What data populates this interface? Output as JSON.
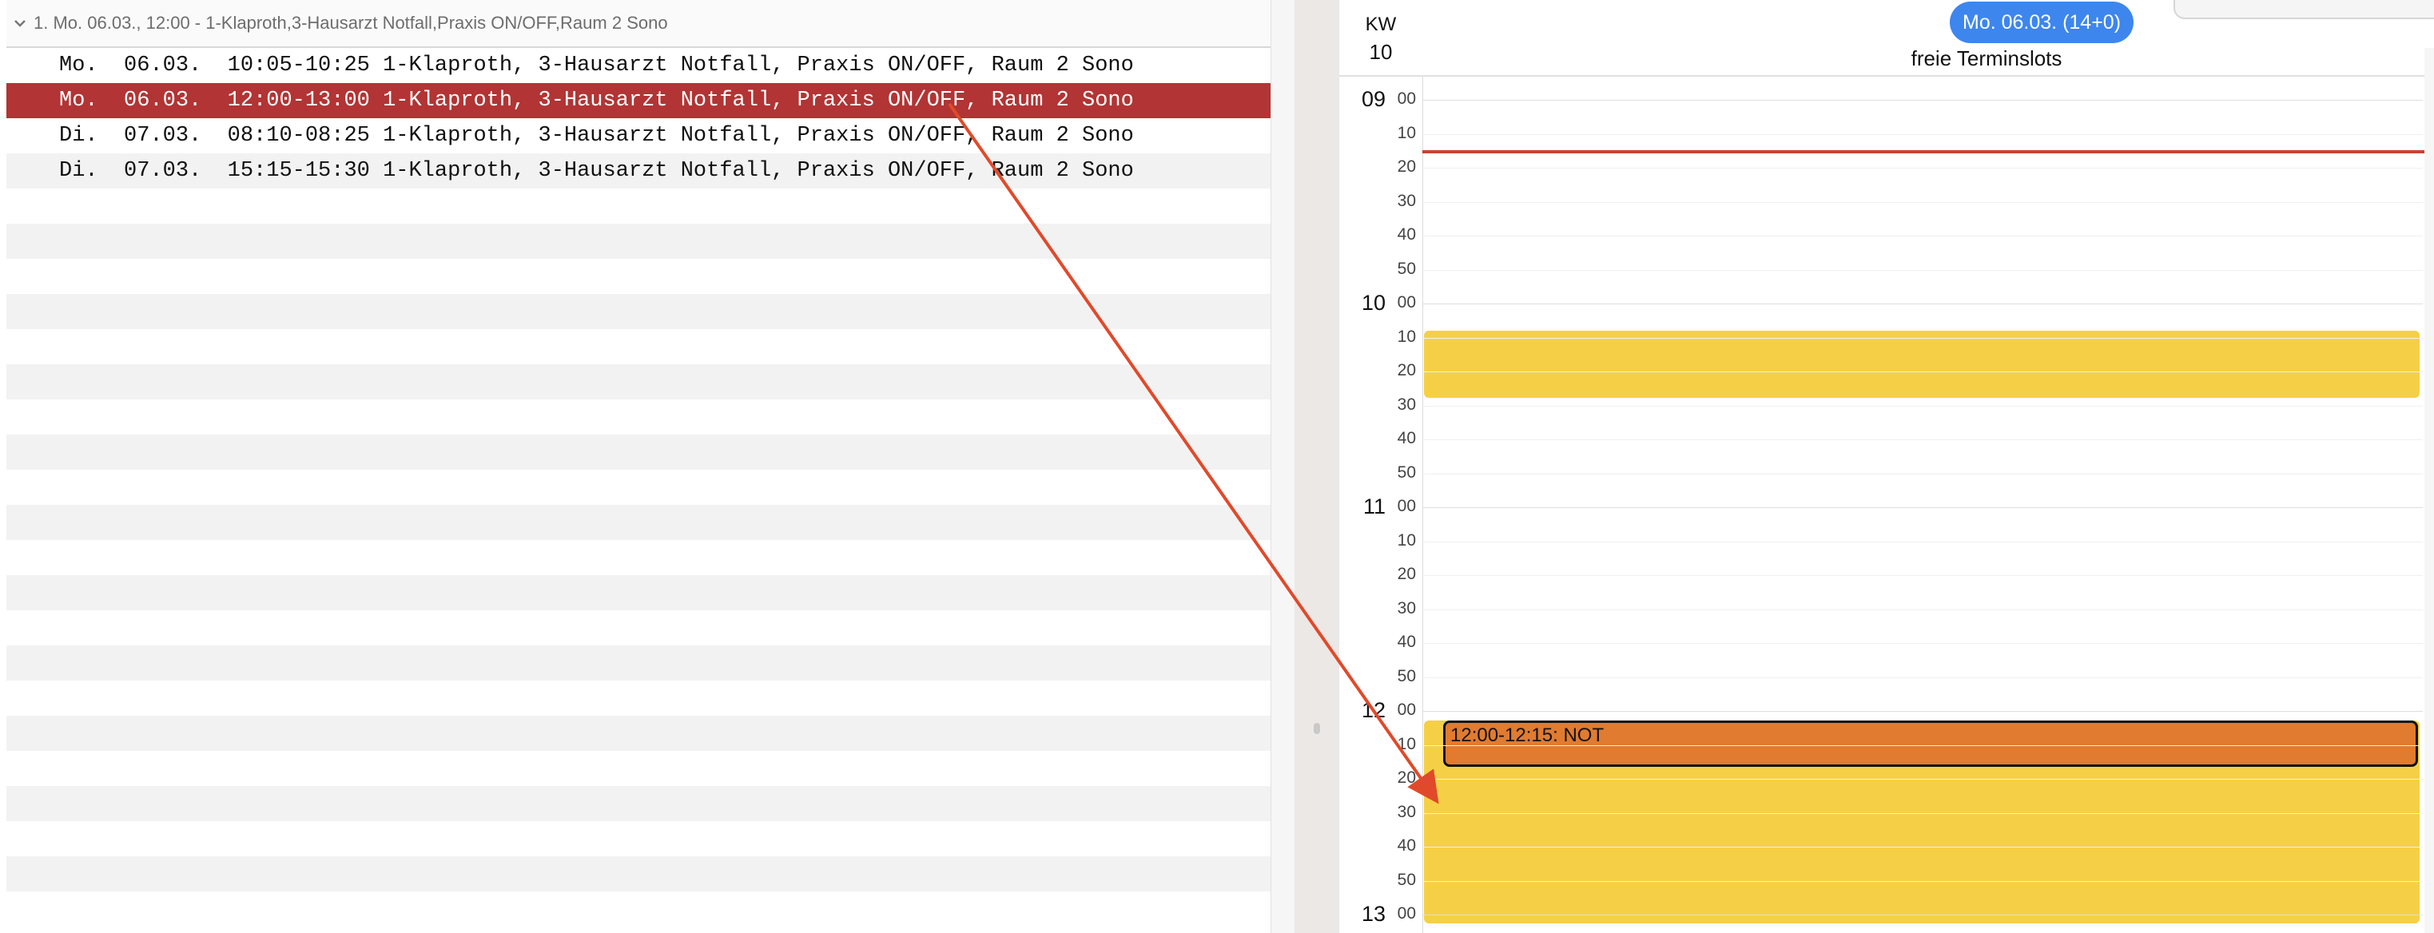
{
  "group_header": "1. Mo. 06.03., 12:00 - 1-Klaproth,3-Hausarzt Notfall,Praxis ON/OFF,Raum 2 Sono",
  "rows": [
    {
      "text": "Mo.  06.03.  10:05-10:25 1-Klaproth, 3-Hausarzt Notfall, Praxis ON/OFF, Raum 2 Sono",
      "selected": false
    },
    {
      "text": "Mo.  06.03.  12:00-13:00 1-Klaproth, 3-Hausarzt Notfall, Praxis ON/OFF, Raum 2 Sono",
      "selected": true
    },
    {
      "text": "Di.  07.03.  08:10-08:25 1-Klaproth, 3-Hausarzt Notfall, Praxis ON/OFF, Raum 2 Sono",
      "selected": false
    },
    {
      "text": "Di.  07.03.  15:15-15:30 1-Klaproth, 3-Hausarzt Notfall, Praxis ON/OFF, Raum 2 Sono",
      "selected": false
    }
  ],
  "calendar": {
    "kw_label": "KW",
    "kw_number": "10",
    "date_pill": "Mo. 06.03. (14+0)",
    "column_title": "freie Terminslots",
    "appointment": "12:00-12:15: NOT",
    "hours": [
      "09",
      "10",
      "11",
      "12",
      "13"
    ],
    "minutes": [
      "00",
      "10",
      "20",
      "30",
      "40",
      "50"
    ]
  },
  "colors": {
    "selected_row": "#b23434",
    "free_slot": "#f5d046",
    "appointment": "#e07b30",
    "now_line": "#c84330",
    "date_pill": "#3d86ee",
    "arrow": "#e04a2a"
  }
}
